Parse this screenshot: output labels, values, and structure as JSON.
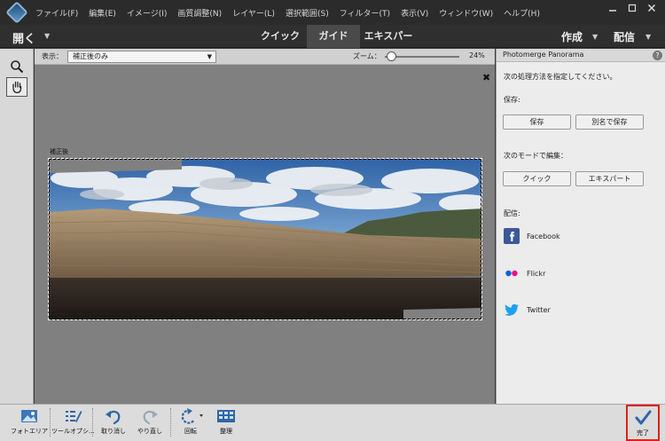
{
  "menu": {
    "items": [
      "ファイル(F)",
      "編集(E)",
      "イメージ(I)",
      "画質調整(N)",
      "レイヤー(L)",
      "選択範囲(S)",
      "フィルター(T)",
      "表示(V)",
      "ウィンドウ(W)",
      "ヘルプ(H)"
    ]
  },
  "modebar": {
    "open_label": "開く",
    "tabs": [
      {
        "label": "クイック",
        "active": false
      },
      {
        "label": "ガイド",
        "active": true
      },
      {
        "label": "エキスパート",
        "active": false
      }
    ],
    "create_label": "作成",
    "share_label": "配信"
  },
  "options": {
    "view_label": "表示：",
    "view_value": "補正後のみ",
    "zoom_label": "ズーム：",
    "zoom_value": "24%",
    "zoom_fraction": 0.24
  },
  "canvas": {
    "after_label": "補正後"
  },
  "panel": {
    "title": "Photomerge Panorama",
    "instruction": "次の処理方法を指定してください。",
    "save_heading": "保存:",
    "save_button": "保存",
    "save_as_button": "別名で保存",
    "edit_heading": "次のモードで編集：",
    "quick_button": "クイック",
    "expert_button": "エキスパート",
    "share_heading": "配信:",
    "share_items": [
      {
        "label": "Facebook",
        "icon": "facebook-icon",
        "color": "#3b5998"
      },
      {
        "label": "Flickr",
        "icon": "flickr-icon",
        "color": "#ff0084"
      },
      {
        "label": "Twitter",
        "icon": "twitter-icon",
        "color": "#1da1f2"
      }
    ]
  },
  "bottombar": {
    "photo_area": "フォトエリア",
    "tool_options": "ツールオプシ...",
    "undo": "取り消し",
    "redo": "やり直し",
    "rotate": "回転",
    "arrange": "整理",
    "done": "完了"
  },
  "colors": {
    "accent_blue": "#1f6fb8",
    "done_highlight": "#e0201a"
  }
}
